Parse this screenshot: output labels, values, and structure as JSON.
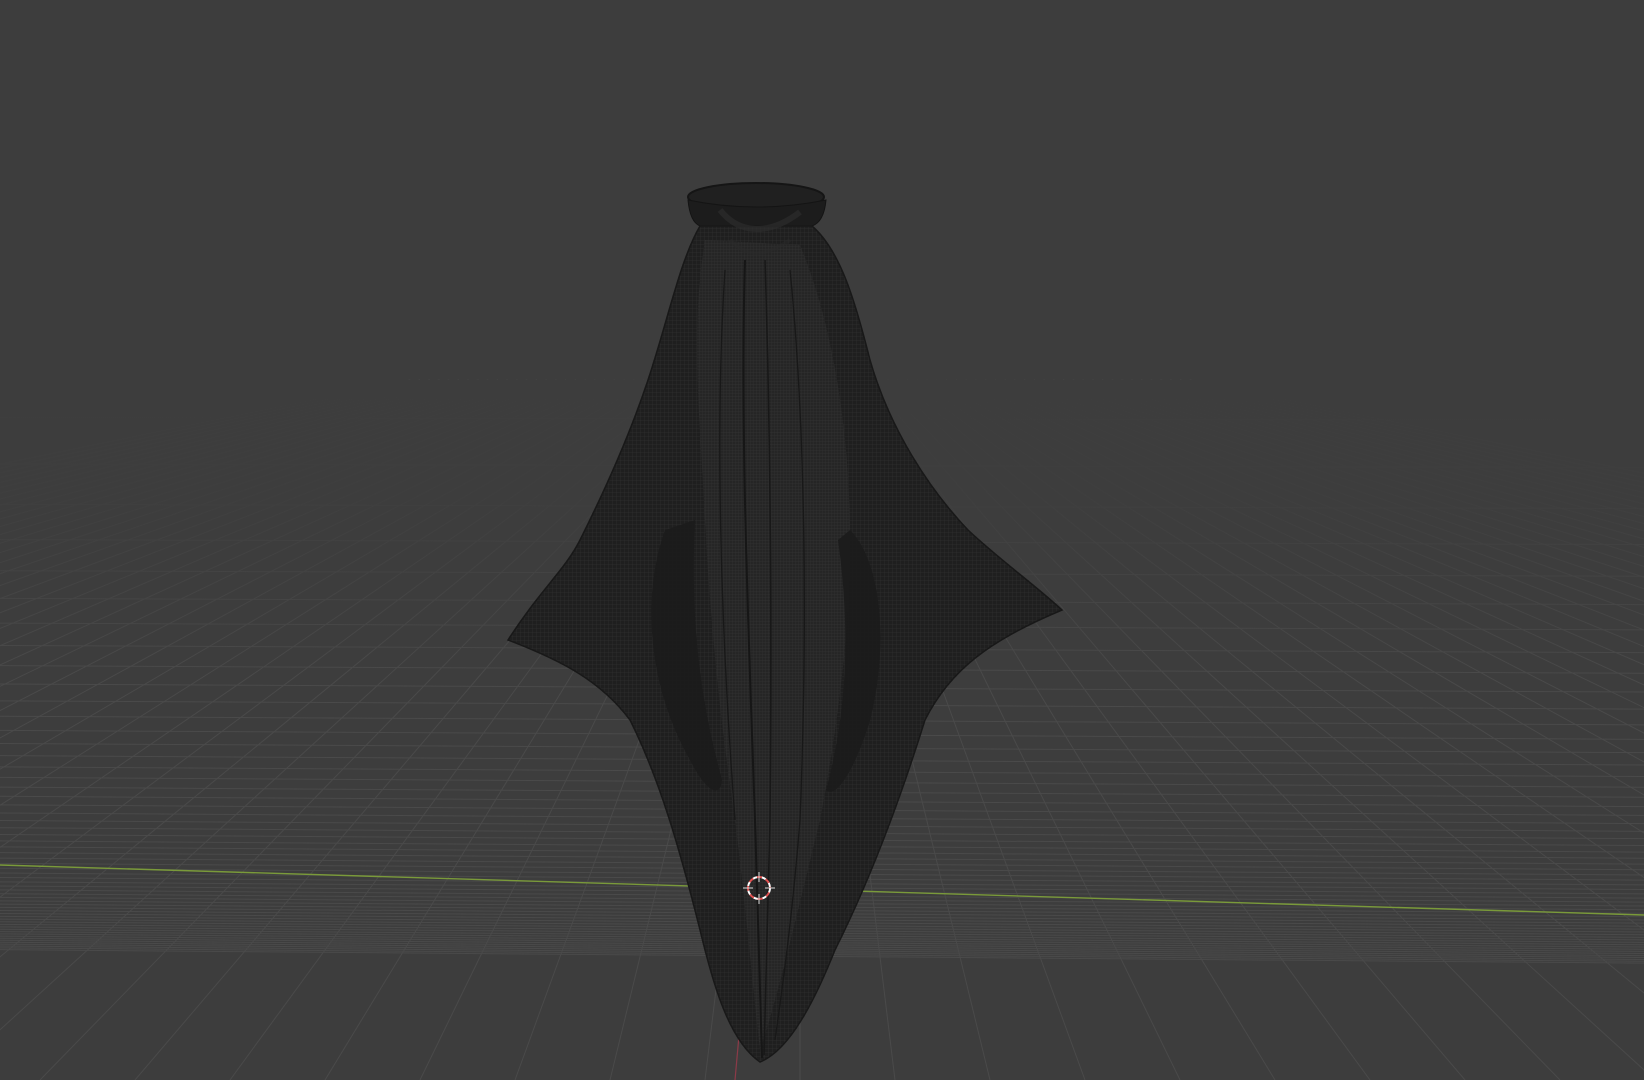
{
  "viewport": {
    "background_color": "#3d3d3d",
    "grid_color": "#4a4a4a",
    "x_axis_color": "#7a9a3a",
    "y_axis_color": "#9a3a4a",
    "object_color": "#1e1e1e",
    "mesh_wire_color": "#2c2c2c",
    "cursor_colors": [
      "#e05050",
      "#ffffff"
    ]
  },
  "scene": {
    "object": "cloth-mesh",
    "shading": "wireframe-overlay",
    "icons": [
      "3d-cursor-icon"
    ]
  }
}
